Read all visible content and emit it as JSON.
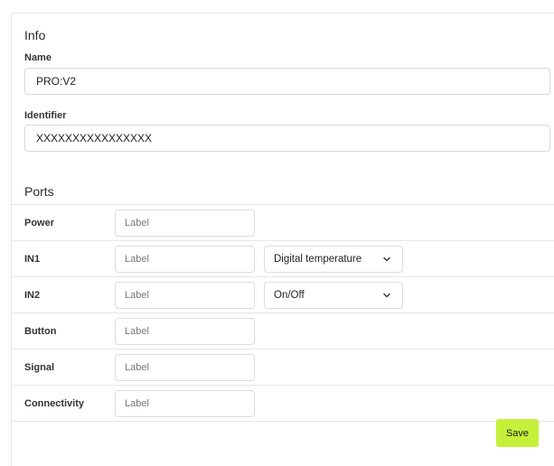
{
  "info": {
    "title": "Info",
    "name_label": "Name",
    "name_value": "PRO:V2",
    "identifier_label": "Identifier",
    "identifier_value": "XXXXXXXXXXXXXXXX"
  },
  "ports": {
    "title": "Ports",
    "label_placeholder": "Label",
    "rows": [
      {
        "name": "Power"
      },
      {
        "name": "IN1",
        "select_value": "Digital temperature"
      },
      {
        "name": "IN2",
        "select_value": "On/Off"
      },
      {
        "name": "Button"
      },
      {
        "name": "Signal"
      },
      {
        "name": "Connectivity"
      }
    ]
  },
  "actions": {
    "save_label": "Save",
    "save_color": "#c6f03a"
  }
}
